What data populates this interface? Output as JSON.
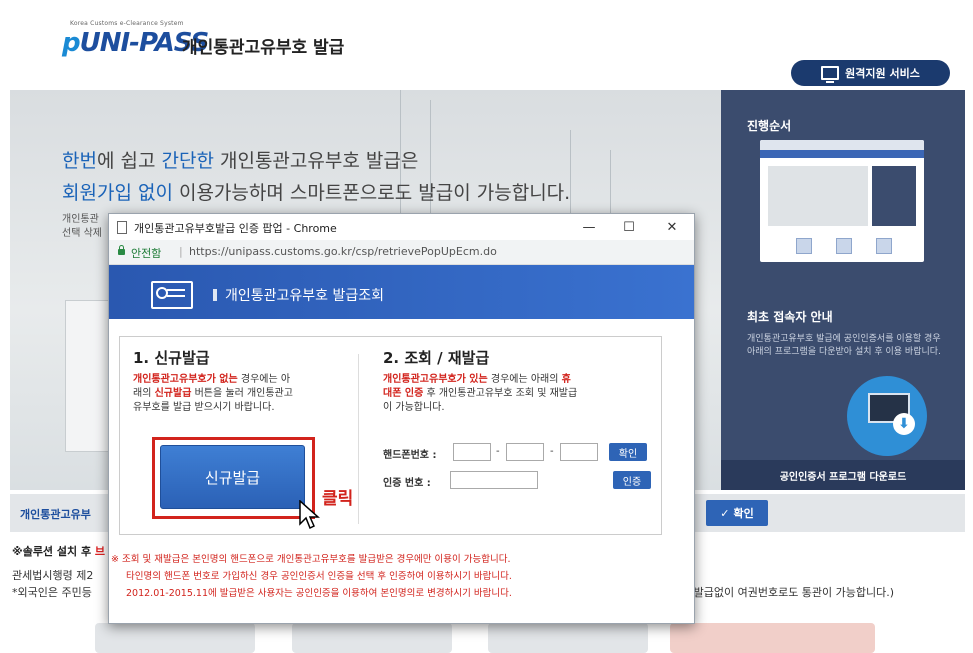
{
  "header": {
    "logo_small": "Korea Customs e-Clearance System",
    "logo_text": "UNI-PASS",
    "logo_p": "p",
    "title": "개인통관고유부호 발급",
    "remote_service": "원격지원 서비스"
  },
  "hero": {
    "line1_hl1": "한번",
    "line1_t1": "에 쉽고 ",
    "line1_hl2": "간단한",
    "line1_t2": " 개인통관고유부호 발급은",
    "line2_hl": "회원가입 없이",
    "line2_t": " 이용가능하며 스마트폰으로도 발급이 가능합니다.",
    "small1": "개인통관",
    "small2": "선택 삭제"
  },
  "side_panel": {
    "process_title": "진행순서",
    "first_visit_title": "최초 접속자 안내",
    "first_visit_desc": "개인통관고유부호 발급에 공인인증서를 이용할 경우 아래의 프로그램을 다운받아 설치 후 이용 바랍니다.",
    "download_label": "공인인증서 프로그램 다운로드"
  },
  "lower": {
    "bar_label": "개인통관고유부",
    "confirm_label": "확인",
    "solution_prefix": "※솔루션 설치 후 ",
    "solution_red": "브",
    "law": "관세법시행령 제2",
    "foreign": "*외국인은 주민등",
    "right_text": "호 발급없이 여권번호로도 통관이 가능합니다.)"
  },
  "popup": {
    "window_title": "개인통관고유부호발급 인증 팝업 - Chrome",
    "min_btn": "—",
    "max_btn": "☐",
    "close_btn": "✕",
    "secure": "안전함",
    "url": "https://unipass.customs.go.kr/csp/retrievePopUpEcm.do",
    "head_title": "개인통관고유부호 발급조회",
    "new": {
      "title": "1. 신규발급",
      "desc_red": "개인통관고유부호가 없는",
      "desc_t1": " 경우에는 아",
      "desc_l2a": "래의 ",
      "desc_red2": "신규발급",
      "desc_l2b": " 버튼을 눌러 개인통관고",
      "desc_l3": "유부호를 발급 받으시기 바랍니다.",
      "button": "신규발급",
      "click_label": "클릭"
    },
    "lookup": {
      "title": "2. 조회 / 재발급",
      "desc_red": "개인통관고유부호가 있는",
      "desc_t1": " 경우에는 아래의 ",
      "desc_red2a": "휴",
      "desc_red2b": "대폰 인증",
      "desc_t2": " 후 개인통관고유부호 조회 및 재발급",
      "desc_l3": "이 가능합니다.",
      "phone_label": "핸드폰번호 :",
      "auth_label": "인증  번호 :",
      "confirm_btn": "확인",
      "auth_btn": "인증",
      "phone1": "",
      "phone2": "",
      "phone3": "",
      "auth_value": ""
    },
    "notes": [
      "※ 조회 및 재발급은 본인명의 핸드폰으로 개인통관고유부호를 발급받은 경우에만 이용이 가능합니다.",
      "타인명의 핸드폰 번호로 가입하신 경우 공인인증서 인증을 선택 후 인증하여 이용하시기 바랍니다.",
      "2012.01-2015.11에 발급받은 사용자는 공인인증을 이용하여 본인명의로 변경하시기 바랍니다."
    ]
  },
  "colors": {
    "brand": "#1d4e9e",
    "accent": "#2e64b6",
    "alert": "#d2231c",
    "panel": "#3b4c6e"
  }
}
